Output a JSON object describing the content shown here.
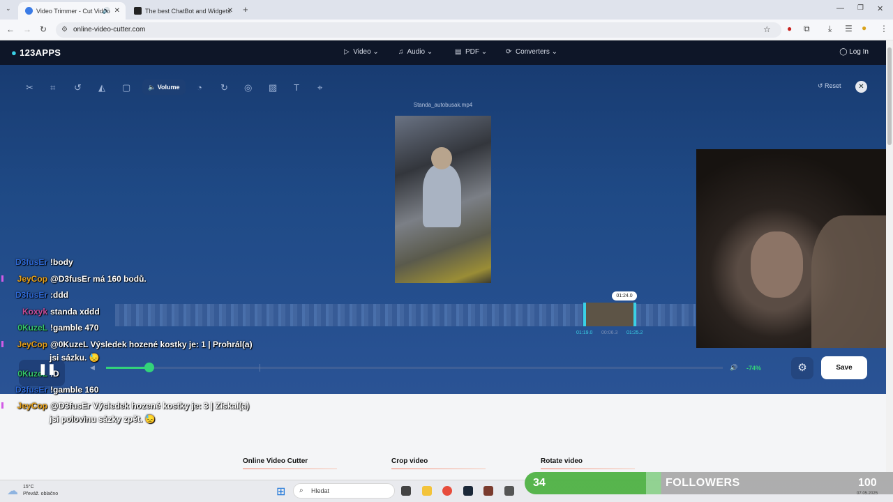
{
  "browser": {
    "tabs": [
      {
        "label": "Video Trimmer - Cut Video"
      },
      {
        "label": "The best ChatBot and Widgets"
      }
    ],
    "url": "online-video-cutter.com"
  },
  "site": {
    "logo": "123APPS",
    "nav": [
      "Video",
      "Audio",
      "PDF",
      "Converters"
    ],
    "login": "Log In",
    "toolbar": {
      "active_label": "Volume"
    },
    "reset": "Reset",
    "filename": "Standa_autobusak.mp4",
    "timeline": {
      "tooltip": "01:24.0",
      "start": "01:19.0",
      "length": "00:06.3",
      "end": "01:25.2"
    },
    "volume": {
      "percent_label": "-74%",
      "level": 0.07
    },
    "save": "Save"
  },
  "chat": [
    {
      "user": "D3fusEr",
      "color": "#2e6ad8",
      "text": "!body"
    },
    {
      "user": "JeyCop",
      "color": "#e8a21b",
      "text": "@D3fusEr má 160 bodů."
    },
    {
      "user": "D3fusEr",
      "color": "#2e6ad8",
      "text": ":ddd"
    },
    {
      "user": "Koxyk",
      "color": "#c74c98",
      "text": "standa xddd"
    },
    {
      "user": "0KuzeL",
      "color": "#35c76d",
      "text": "!gamble 470"
    },
    {
      "user": "JeyCop",
      "color": "#e8a21b",
      "text": "@0KuzeL Výsledek hozené kostky je: 1 | Prohrál(a)",
      "cont": "jsi sázku. 😓"
    },
    {
      "user": "0KuzeL",
      "color": "#35c76d",
      "text": ":D"
    },
    {
      "user": "D3fusEr",
      "color": "#2e6ad8",
      "text": "!gamble 160"
    },
    {
      "user": "JeyCop",
      "color": "#e8a21b",
      "text": "@D3fusEr Výsledek hozené kostky je: 3 | Získal(a)",
      "cont": "jsi polovinu sázky zpět. 😓"
    }
  ],
  "footer": {
    "links": [
      "Online Video Cutter",
      "Crop video",
      "Rotate video"
    ]
  },
  "taskbar": {
    "temp": "15°C",
    "weather": "Převáž. oblačno",
    "search": "Hledat"
  },
  "followers": {
    "count": "34",
    "label": "FOLLOWERS",
    "goal": "100",
    "progress": 0.34
  },
  "date": "07.05.2025"
}
